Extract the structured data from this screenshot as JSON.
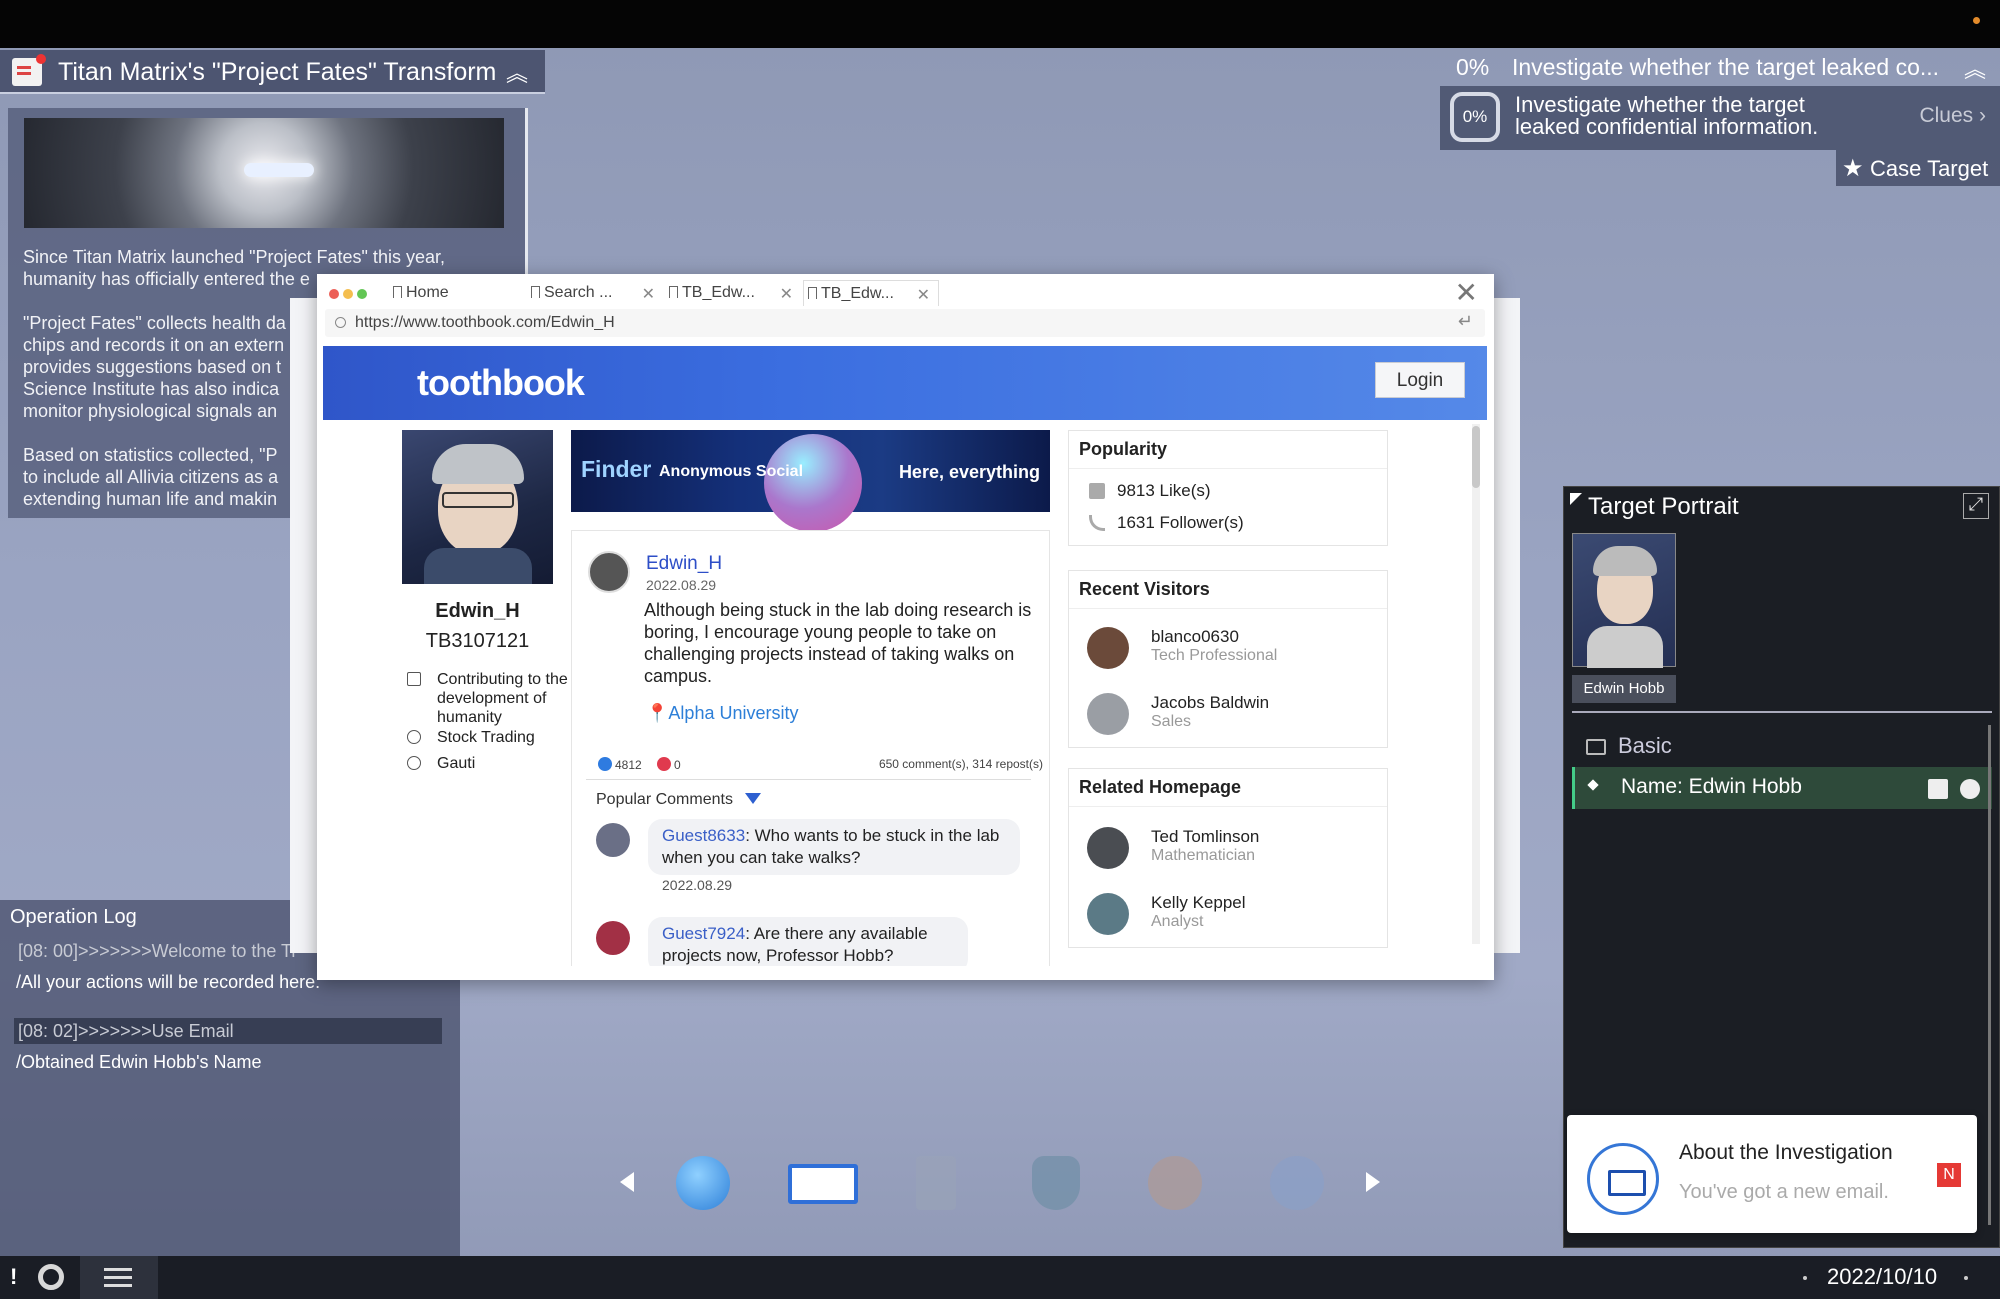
{
  "news": {
    "title": "Titan Matrix's \"Project Fates\" Transform",
    "body": "Since Titan Matrix launched \"Project Fates\" this year,\nhumanity has officially entered the e\n\n\"Project Fates\" collects health da\nchips and records it on an extern\nprovides suggestions based on t\nScience Institute has also indica\nmonitor physiological signals an\n\nBased on statistics collected, \"P\nto include all Allivia citizens as a\nextending human life and makin"
  },
  "task": {
    "percent": "0%",
    "label": "Investigate whether the target leaked co...",
    "description": "Investigate whether the target leaked confidential information.",
    "clues": "Clues",
    "case_target": "Case Target"
  },
  "browser": {
    "tabs": [
      "Home",
      "Search ...",
      "TB_Edw...",
      "TB_Edw..."
    ],
    "url": "https://www.toothbook.com/Edwin_H"
  },
  "toothbook": {
    "logo": "toothbook",
    "login": "Login",
    "profile": {
      "name": "Edwin_H",
      "id": "TB3107121",
      "info": [
        "Contributing to the development of humanity",
        "Stock Trading",
        "Gauti"
      ]
    },
    "banner": {
      "title": "Finder",
      "subtitle": "Anonymous Social",
      "right": "Here, everything"
    },
    "post": {
      "user": "Edwin_H",
      "date": "2022.08.29",
      "body": "Although being stuck in the lab doing research is boring, I encourage young people to take on challenging projects instead of taking walks on campus.",
      "location": "Alpha University",
      "likes": "4812",
      "dislikes": "0",
      "comments_reposts": "650 comment(s),  314 repost(s)",
      "popular_comments": "Popular Comments"
    },
    "comments": [
      {
        "user": "Guest8633",
        "text": ": Who wants to be stuck in the lab when you can take walks?",
        "date": "2022.08.29"
      },
      {
        "user": "Guest7924",
        "text": ": Are there any available projects now, Professor Hobb?"
      }
    ],
    "popularity": {
      "title": "Popularity",
      "likes": "9813  Like(s)",
      "followers": "1631  Follower(s)"
    },
    "visitors": {
      "title": "Recent Visitors",
      "items": [
        {
          "name": "blanco0630",
          "role": "Tech Professional"
        },
        {
          "name": "Jacobs Baldwin",
          "role": "Sales"
        }
      ]
    },
    "related": {
      "title": "Related Homepage",
      "items": [
        {
          "name": "Ted Tomlinson",
          "role": "Mathematician"
        },
        {
          "name": "Kelly Keppel",
          "role": "Analyst"
        }
      ]
    }
  },
  "target": {
    "title": "Target Portrait",
    "caption": "Edwin Hobb",
    "basic": "Basic",
    "name_row": "Name: Edwin Hobb"
  },
  "notification": {
    "title": "About the Investigation",
    "subtitle": "You've got a new email.",
    "badge": "N"
  },
  "oplog": {
    "title": "Operation Log",
    "lines": [
      {
        "head": "[08: 00]>>>>>>>Welcome to the Ti",
        "sub": "/All your actions will be recorded here."
      },
      {
        "head": "[08: 02]>>>>>>>Use Email",
        "sub": "/Obtained Edwin Hobb's Name"
      }
    ]
  },
  "dock": {
    "icons": [
      "browser-globe-icon",
      "email-icon",
      "document-icon",
      "shield-icon",
      "hi-chat-icon",
      "phone-icon"
    ]
  },
  "status": {
    "alert": "!",
    "date": "2022/10/10"
  }
}
